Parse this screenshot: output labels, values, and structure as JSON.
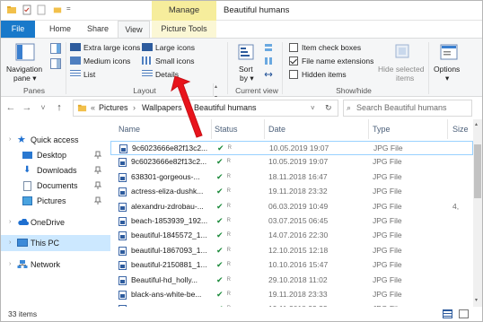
{
  "window": {
    "title": "Beautiful humans",
    "context_tab": "Manage"
  },
  "tabs": {
    "file": "File",
    "home": "Home",
    "share": "Share",
    "view": "View",
    "picture_tools": "Picture Tools"
  },
  "ribbon": {
    "panes": {
      "navigation_pane": "Navigation",
      "navigation_pane2": "pane ▾",
      "label": "Panes"
    },
    "layout": {
      "extra_large": "Extra large icons",
      "large": "Large icons",
      "medium": "Medium icons",
      "small": "Small icons",
      "list": "List",
      "details": "Details",
      "label": "Layout"
    },
    "current_view": {
      "sort_by": "Sort",
      "sort_by2": "by ▾",
      "label": "Current view"
    },
    "show_hide": {
      "item_check_boxes": "Item check boxes",
      "file_name_extensions": "File name extensions",
      "hidden_items": "Hidden items",
      "hide_selected": "Hide selected",
      "hide_selected2": "items",
      "label": "Show/hide",
      "checks": {
        "item_check_boxes": false,
        "file_name_extensions": true,
        "hidden_items": false
      }
    },
    "options": {
      "label": "Options",
      "label2": "▾"
    }
  },
  "address": {
    "back": "←",
    "forward": "→",
    "recent": "˅",
    "up": "↑",
    "prefix": "«",
    "crumbs": [
      "Pictures",
      "Wallpapers",
      "Beautiful humans"
    ],
    "search_placeholder": "Search Beautiful humans"
  },
  "nav": {
    "quick_access": "Quick access",
    "desktop": "Desktop",
    "downloads": "Downloads",
    "documents": "Documents",
    "pictures": "Pictures",
    "onedrive": "OneDrive",
    "this_pc": "This PC",
    "network": "Network"
  },
  "columns": {
    "name": "Name",
    "status": "Status",
    "date": "Date",
    "type": "Type",
    "size": "Size"
  },
  "files": [
    {
      "name": "9c6023666e82f13c2...",
      "date": "10.05.2019 19:07",
      "type": "JPG File",
      "size": ""
    },
    {
      "name": "9c6023666e82f13c2...",
      "date": "10.05.2019 19:07",
      "type": "JPG File",
      "size": ""
    },
    {
      "name": "638301-gorgeous-...",
      "date": "18.11.2018 16:47",
      "type": "JPG File",
      "size": ""
    },
    {
      "name": "actress-eliza-dushk...",
      "date": "19.11.2018 23:32",
      "type": "JPG File",
      "size": ""
    },
    {
      "name": "alexandru-zdrobau-...",
      "date": "06.03.2019 10:49",
      "type": "JPG File",
      "size": "4,"
    },
    {
      "name": "beach-1853939_192...",
      "date": "03.07.2015 06:45",
      "type": "JPG File",
      "size": ""
    },
    {
      "name": "beautiful-1845572_1...",
      "date": "14.07.2016 22:30",
      "type": "JPG File",
      "size": ""
    },
    {
      "name": "beautiful-1867093_1...",
      "date": "12.10.2015 12:18",
      "type": "JPG File",
      "size": ""
    },
    {
      "name": "beautiful-2150881_1...",
      "date": "10.10.2016 15:47",
      "type": "JPG File",
      "size": ""
    },
    {
      "name": "Beautiful-hd_holly...",
      "date": "29.10.2018 11:02",
      "type": "JPG File",
      "size": ""
    },
    {
      "name": "black-ans-white-be...",
      "date": "19.11.2018 23:33",
      "type": "JPG File",
      "size": ""
    },
    {
      "name": "...",
      "date": "19.11.2018 23:33",
      "type": "JPG File",
      "size": ""
    }
  ],
  "status_ok": "✔",
  "status_people": "ᴿ",
  "statusbar": {
    "count": "33 items"
  },
  "colors": {
    "file_tab": "#1979ca",
    "manage_tab": "#f6ed9c",
    "selection": "#cce8ff",
    "arrow": "#e8141c"
  }
}
